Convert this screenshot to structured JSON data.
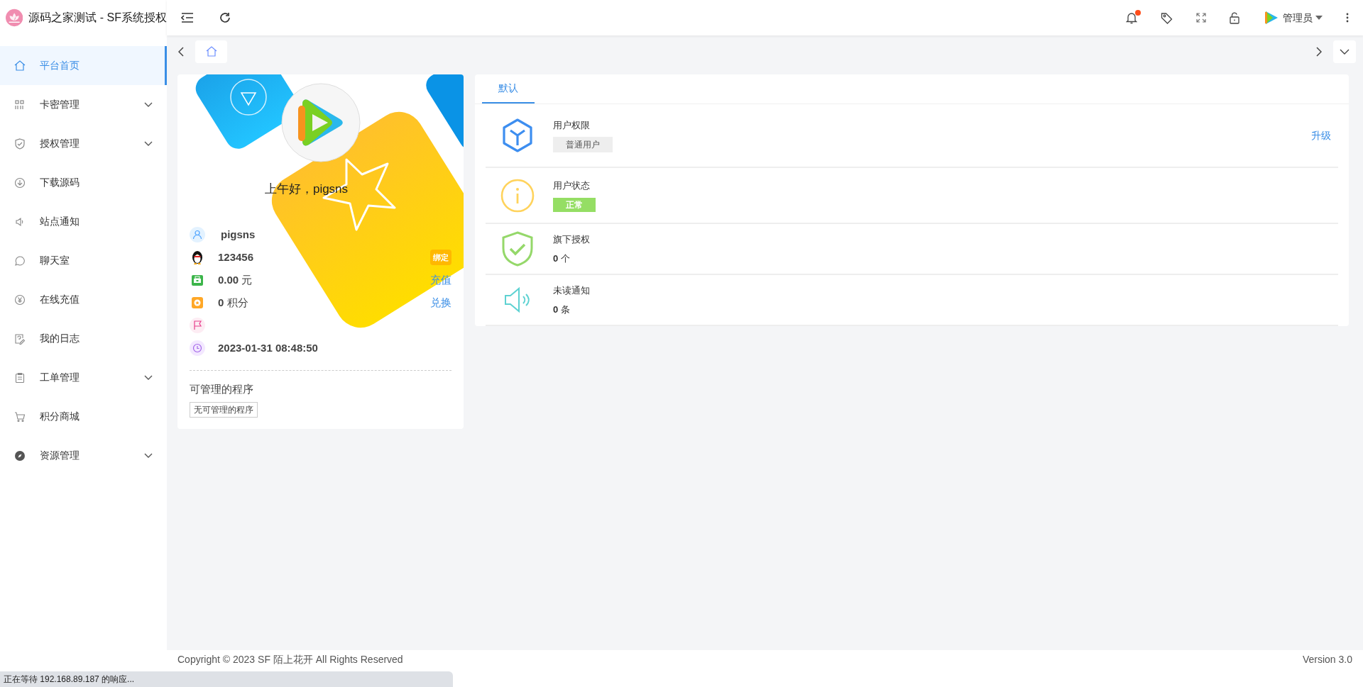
{
  "header": {
    "site_title": "源码之家测试 - SF系统授权",
    "user_name": "管理员",
    "has_unread": true
  },
  "sidebar": {
    "items": [
      {
        "label": "平台首页",
        "selected": true,
        "expandable": false
      },
      {
        "label": "卡密管理",
        "selected": false,
        "expandable": true
      },
      {
        "label": "授权管理",
        "selected": false,
        "expandable": true
      },
      {
        "label": "下载源码",
        "selected": false,
        "expandable": false
      },
      {
        "label": "站点通知",
        "selected": false,
        "expandable": false
      },
      {
        "label": "聊天室",
        "selected": false,
        "expandable": false
      },
      {
        "label": "在线充值",
        "selected": false,
        "expandable": false
      },
      {
        "label": "我的日志",
        "selected": false,
        "expandable": false
      },
      {
        "label": "工单管理",
        "selected": false,
        "expandable": true
      },
      {
        "label": "积分商城",
        "selected": false,
        "expandable": false
      },
      {
        "label": "资源管理",
        "selected": false,
        "expandable": true
      }
    ]
  },
  "card": {
    "greeting": "上午好，pigsns",
    "fields": [
      {
        "kind": "user",
        "value": "pigsns"
      },
      {
        "kind": "qq",
        "value": "123456",
        "action": "绑定"
      },
      {
        "kind": "balance",
        "value": "0.00",
        "unit": "元",
        "action": "充值"
      },
      {
        "kind": "points",
        "value": "0",
        "unit": "积分",
        "action": "兑换"
      },
      {
        "kind": "flag"
      },
      {
        "kind": "time",
        "value": "2023-01-31 08:48:50"
      }
    ],
    "programs_title": "可管理的程序",
    "programs_tag": "无可管理的程序"
  },
  "panel": {
    "tabs": [
      {
        "label": "默认",
        "selected": true
      }
    ],
    "rows": [
      {
        "kind": "permission",
        "title": "用户权限",
        "tag": "普通用户",
        "action": "升级"
      },
      {
        "kind": "status",
        "title": "用户状态",
        "tag": "正常"
      },
      {
        "kind": "licenses",
        "title": "旗下授权",
        "count": "0",
        "unit": "个"
      },
      {
        "kind": "notices",
        "title": "未读通知",
        "count": "0",
        "unit": "条"
      }
    ]
  },
  "footer": {
    "copyright": "Copyright © 2023 SF 陌上花开 All Rights Reserved",
    "version": "Version 3.0"
  },
  "status_bar": {
    "text": "正在等待 192.168.89.187 的响应..."
  }
}
